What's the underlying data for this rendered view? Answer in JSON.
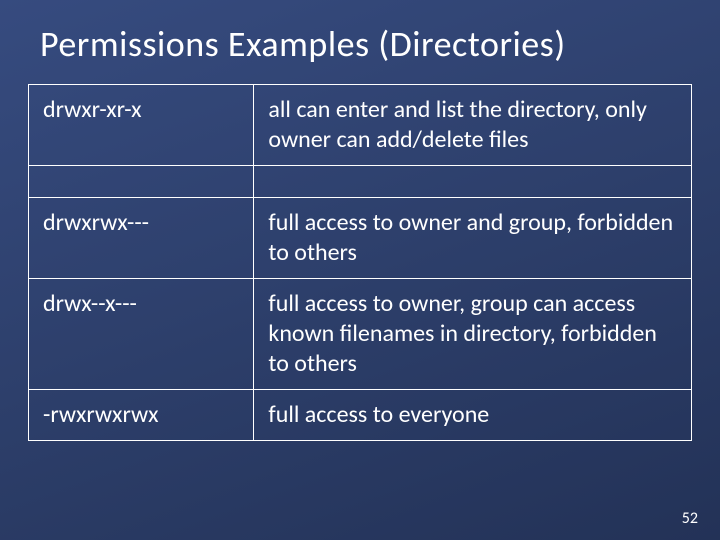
{
  "title": "Permissions Examples (Directories)",
  "rows": [
    {
      "perm": "drwxr-xr-x",
      "desc": "all can enter and list the directory, only owner can add/delete files"
    },
    {
      "perm": "drwxrwx---",
      "desc": "full access to owner and group, forbidden to others"
    },
    {
      "perm": "drwx--x---",
      "desc": "full access to owner, group can access known filenames in directory, forbidden to others"
    },
    {
      "perm": "-rwxrwxrwx",
      "desc": "full access to everyone"
    }
  ],
  "slide_number": "52"
}
